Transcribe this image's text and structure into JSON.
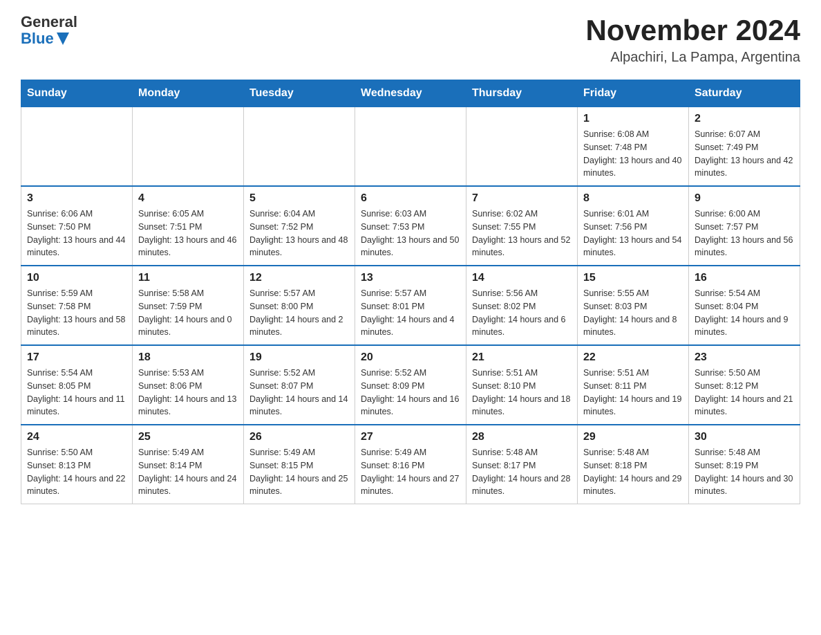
{
  "header": {
    "logo": {
      "general": "General",
      "blue": "Blue"
    },
    "title": "November 2024",
    "subtitle": "Alpachiri, La Pampa, Argentina"
  },
  "calendar": {
    "weekdays": [
      "Sunday",
      "Monday",
      "Tuesday",
      "Wednesday",
      "Thursday",
      "Friday",
      "Saturday"
    ],
    "weeks": [
      [
        {
          "day": "",
          "info": ""
        },
        {
          "day": "",
          "info": ""
        },
        {
          "day": "",
          "info": ""
        },
        {
          "day": "",
          "info": ""
        },
        {
          "day": "",
          "info": ""
        },
        {
          "day": "1",
          "info": "Sunrise: 6:08 AM\nSunset: 7:48 PM\nDaylight: 13 hours and 40 minutes."
        },
        {
          "day": "2",
          "info": "Sunrise: 6:07 AM\nSunset: 7:49 PM\nDaylight: 13 hours and 42 minutes."
        }
      ],
      [
        {
          "day": "3",
          "info": "Sunrise: 6:06 AM\nSunset: 7:50 PM\nDaylight: 13 hours and 44 minutes."
        },
        {
          "day": "4",
          "info": "Sunrise: 6:05 AM\nSunset: 7:51 PM\nDaylight: 13 hours and 46 minutes."
        },
        {
          "day": "5",
          "info": "Sunrise: 6:04 AM\nSunset: 7:52 PM\nDaylight: 13 hours and 48 minutes."
        },
        {
          "day": "6",
          "info": "Sunrise: 6:03 AM\nSunset: 7:53 PM\nDaylight: 13 hours and 50 minutes."
        },
        {
          "day": "7",
          "info": "Sunrise: 6:02 AM\nSunset: 7:55 PM\nDaylight: 13 hours and 52 minutes."
        },
        {
          "day": "8",
          "info": "Sunrise: 6:01 AM\nSunset: 7:56 PM\nDaylight: 13 hours and 54 minutes."
        },
        {
          "day": "9",
          "info": "Sunrise: 6:00 AM\nSunset: 7:57 PM\nDaylight: 13 hours and 56 minutes."
        }
      ],
      [
        {
          "day": "10",
          "info": "Sunrise: 5:59 AM\nSunset: 7:58 PM\nDaylight: 13 hours and 58 minutes."
        },
        {
          "day": "11",
          "info": "Sunrise: 5:58 AM\nSunset: 7:59 PM\nDaylight: 14 hours and 0 minutes."
        },
        {
          "day": "12",
          "info": "Sunrise: 5:57 AM\nSunset: 8:00 PM\nDaylight: 14 hours and 2 minutes."
        },
        {
          "day": "13",
          "info": "Sunrise: 5:57 AM\nSunset: 8:01 PM\nDaylight: 14 hours and 4 minutes."
        },
        {
          "day": "14",
          "info": "Sunrise: 5:56 AM\nSunset: 8:02 PM\nDaylight: 14 hours and 6 minutes."
        },
        {
          "day": "15",
          "info": "Sunrise: 5:55 AM\nSunset: 8:03 PM\nDaylight: 14 hours and 8 minutes."
        },
        {
          "day": "16",
          "info": "Sunrise: 5:54 AM\nSunset: 8:04 PM\nDaylight: 14 hours and 9 minutes."
        }
      ],
      [
        {
          "day": "17",
          "info": "Sunrise: 5:54 AM\nSunset: 8:05 PM\nDaylight: 14 hours and 11 minutes."
        },
        {
          "day": "18",
          "info": "Sunrise: 5:53 AM\nSunset: 8:06 PM\nDaylight: 14 hours and 13 minutes."
        },
        {
          "day": "19",
          "info": "Sunrise: 5:52 AM\nSunset: 8:07 PM\nDaylight: 14 hours and 14 minutes."
        },
        {
          "day": "20",
          "info": "Sunrise: 5:52 AM\nSunset: 8:09 PM\nDaylight: 14 hours and 16 minutes."
        },
        {
          "day": "21",
          "info": "Sunrise: 5:51 AM\nSunset: 8:10 PM\nDaylight: 14 hours and 18 minutes."
        },
        {
          "day": "22",
          "info": "Sunrise: 5:51 AM\nSunset: 8:11 PM\nDaylight: 14 hours and 19 minutes."
        },
        {
          "day": "23",
          "info": "Sunrise: 5:50 AM\nSunset: 8:12 PM\nDaylight: 14 hours and 21 minutes."
        }
      ],
      [
        {
          "day": "24",
          "info": "Sunrise: 5:50 AM\nSunset: 8:13 PM\nDaylight: 14 hours and 22 minutes."
        },
        {
          "day": "25",
          "info": "Sunrise: 5:49 AM\nSunset: 8:14 PM\nDaylight: 14 hours and 24 minutes."
        },
        {
          "day": "26",
          "info": "Sunrise: 5:49 AM\nSunset: 8:15 PM\nDaylight: 14 hours and 25 minutes."
        },
        {
          "day": "27",
          "info": "Sunrise: 5:49 AM\nSunset: 8:16 PM\nDaylight: 14 hours and 27 minutes."
        },
        {
          "day": "28",
          "info": "Sunrise: 5:48 AM\nSunset: 8:17 PM\nDaylight: 14 hours and 28 minutes."
        },
        {
          "day": "29",
          "info": "Sunrise: 5:48 AM\nSunset: 8:18 PM\nDaylight: 14 hours and 29 minutes."
        },
        {
          "day": "30",
          "info": "Sunrise: 5:48 AM\nSunset: 8:19 PM\nDaylight: 14 hours and 30 minutes."
        }
      ]
    ]
  }
}
